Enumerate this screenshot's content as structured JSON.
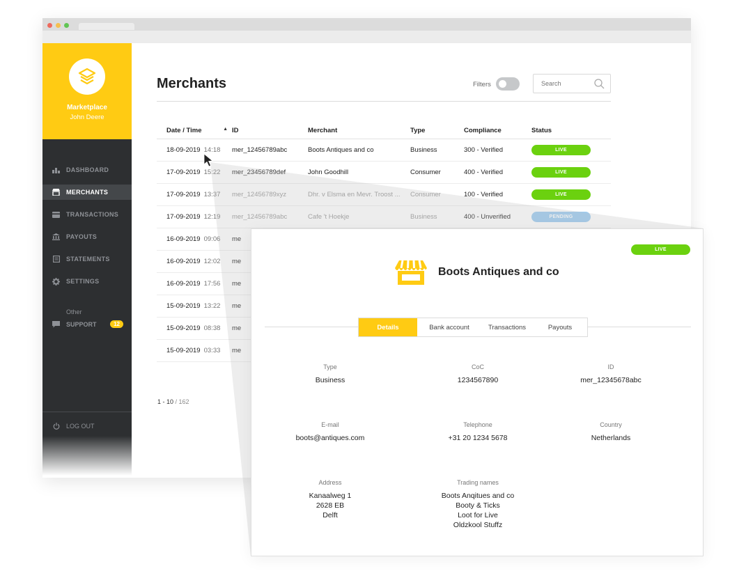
{
  "app": {
    "brand_name": "Marketplace",
    "user_name": "John Deere"
  },
  "sidebar": {
    "items": [
      {
        "label": "DASHBOARD",
        "icon": "bar-chart-icon",
        "active": false
      },
      {
        "label": "MERCHANTS",
        "icon": "storefront-icon",
        "active": true
      },
      {
        "label": "TRANSACTIONS",
        "icon": "credit-card-icon",
        "active": false
      },
      {
        "label": "PAYOUTS",
        "icon": "bank-icon",
        "active": false
      },
      {
        "label": "STATEMENTS",
        "icon": "document-icon",
        "active": false
      },
      {
        "label": "SETTINGS",
        "icon": "gear-icon",
        "active": false
      }
    ],
    "other_label": "Other",
    "support_label": "SUPPORT",
    "support_count": "12",
    "logout_label": "LOG OUT"
  },
  "main": {
    "title": "Merchants",
    "filters_label": "Filters",
    "search_placeholder": "Search",
    "columns": [
      "Date / Time",
      "ID",
      "Merchant",
      "Type",
      "Compliance",
      "Status"
    ],
    "rows": [
      {
        "date": "18-09-2019",
        "time": "14:18",
        "id": "mer_12456789abc",
        "merchant": "Boots Antiques and co",
        "type": "Business",
        "compliance": "300 - Verified",
        "status": "LIVE"
      },
      {
        "date": "17-09-2019",
        "time": "15:22",
        "id": "mer_23456789def",
        "merchant": "John Goodhill",
        "type": "Consumer",
        "compliance": "400 - Verified",
        "status": "LIVE"
      },
      {
        "date": "17-09-2019",
        "time": "13:37",
        "id": "mer_12456789xyz",
        "merchant": "Dhr. v Elsma en Mevr. Troost ...",
        "type": "Consumer",
        "compliance": "100 - Verified",
        "status": "LIVE"
      },
      {
        "date": "17-09-2019",
        "time": "12:19",
        "id": "mer_12456789abc",
        "merchant": "Cafe 't Hoekje",
        "type": "Business",
        "compliance": "400 - Unverified",
        "status": "PENDING"
      },
      {
        "date": "16-09-2019",
        "time": "09:06",
        "id": "me",
        "merchant": "",
        "type": "",
        "compliance": "",
        "status": ""
      },
      {
        "date": "16-09-2019",
        "time": "12:02",
        "id": "me",
        "merchant": "",
        "type": "",
        "compliance": "",
        "status": ""
      },
      {
        "date": "16-09-2019",
        "time": "17:56",
        "id": "me",
        "merchant": "",
        "type": "",
        "compliance": "",
        "status": ""
      },
      {
        "date": "15-09-2019",
        "time": "13:22",
        "id": "me",
        "merchant": "",
        "type": "",
        "compliance": "",
        "status": ""
      },
      {
        "date": "15-09-2019",
        "time": "08:38",
        "id": "me",
        "merchant": "",
        "type": "",
        "compliance": "",
        "status": ""
      },
      {
        "date": "15-09-2019",
        "time": "03:33",
        "id": "me",
        "merchant": "",
        "type": "",
        "compliance": "",
        "status": ""
      }
    ],
    "pagination_range": "1 - 10",
    "pagination_sep": " / ",
    "pagination_total": "162"
  },
  "detail": {
    "status": "LIVE",
    "title": "Boots Antiques and co",
    "tabs": [
      "Details",
      "Bank account",
      "Transactions",
      "Payouts"
    ],
    "fields": {
      "type": {
        "label": "Type",
        "value": "Business"
      },
      "coc": {
        "label": "CoC",
        "value": "1234567890"
      },
      "id": {
        "label": "ID",
        "value": "mer_12345678abc"
      },
      "email": {
        "label": "E-mail",
        "value": "boots@antiques.com"
      },
      "telephone": {
        "label": "Telephone",
        "value": "+31 20 1234 5678"
      },
      "country": {
        "label": "Country",
        "value": "Netherlands"
      },
      "address": {
        "label": "Address",
        "lines": [
          "Kanaalweg 1",
          "2628 EB",
          "Delft"
        ]
      },
      "trading_names": {
        "label": "Trading names",
        "lines": [
          "Boots Anqitues and co",
          "Booty & Ticks",
          "Loot for Live",
          "Oldzkool Stuffz"
        ]
      }
    }
  },
  "colors": {
    "accent": "#ffcb13",
    "sidebar_bg": "#2d2f31",
    "live": "#6bd10f",
    "pending": "#9ccbf0"
  }
}
